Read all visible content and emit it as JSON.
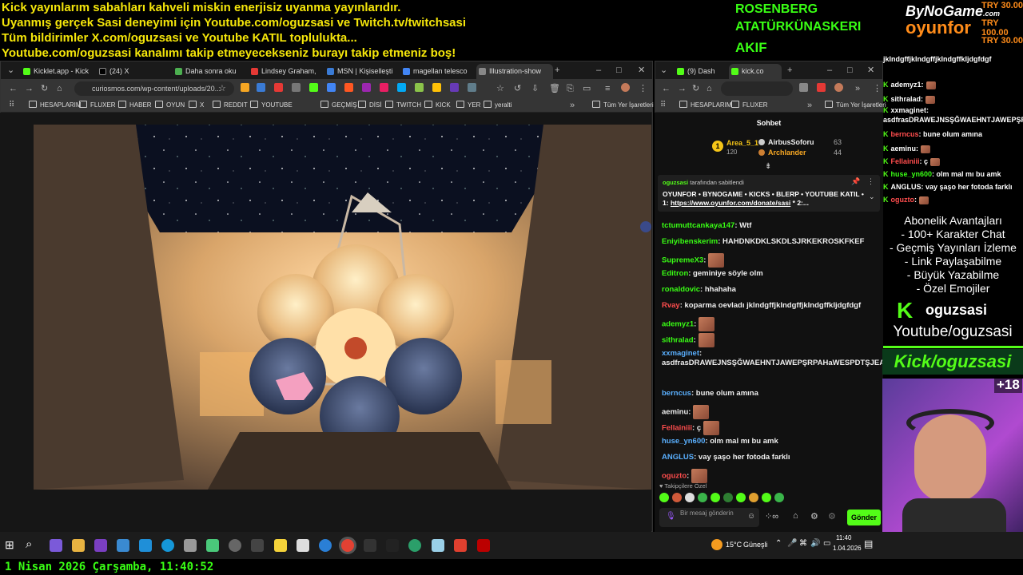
{
  "ticker": [
    "Kick yayınlarım sabahları kahveli miskin enerjisiz uyanma yayınlarıdır.",
    "Uyanmış gerçek Sasi deneyimi için Youtube.com/oguzsasi ve Twitch.tv/twitchsasi",
    "Tüm bildirimler X.com/oguzsasi ve Youtube KATIL toplulukta...",
    "Youtube.com/oguzsasi kanalımı takip etmeyecekseniz burayı takip etmeniz boş!"
  ],
  "donors": [
    "ROSENBERG",
    "ATATÜRKÜNASKERI",
    "AKIF"
  ],
  "sponsor": {
    "brand1": "ByNoGame",
    "brand1_suffix": ".com",
    "brand2": "oyunfor",
    "amounts": [
      "TRY 30.00",
      "TRY 100.00",
      "TRY 30.00"
    ]
  },
  "left_browser": {
    "tabs": [
      "Kicklet.app - Kick",
      "(24) X",
      "Daha sonra oku",
      "Lindsey Graham,",
      "MSN | Kişiselleşti",
      "magellan telesco",
      "Illustration-show"
    ],
    "url": "curiosmos.com/wp-content/uploads/20...",
    "bookmarks": [
      "HESAPLARIM",
      "FLUXER",
      "HABER",
      "OYUN",
      "X",
      "REDDIT",
      "YOUTUBE",
      "GEÇMİŞ",
      "DİSİ",
      "TWITCH",
      "KICK",
      "YER",
      "yeralti"
    ],
    "all_bookmarks": "Tüm Yer İşaretleri"
  },
  "right_browser": {
    "tabs": [
      "(9) Dash",
      "kick.co"
    ],
    "bookmarks": [
      "HESAPLARIM",
      "FLUXER"
    ],
    "all_bookmarks": "Tüm Yer İşaretleri"
  },
  "chat": {
    "title": "Sohbet",
    "leader": {
      "rank": "1",
      "name": "Area_5_1",
      "count": "120"
    },
    "top": [
      {
        "name": "AirbusSoforu",
        "count": "63"
      },
      {
        "name": "Archlander",
        "count": "44"
      }
    ],
    "pinned_by": "oguzsasi",
    "pinned_suffix": "tarafından sabitlendi",
    "pinned_text": "OYUNFOR • BYNOGAME • KICKS • BLERP • YOUTUBE KATIL • 1:",
    "pinned_link": "https://www.oyunfor.com/donate/sasi",
    "pinned_more": "* 2:...",
    "messages": [
      {
        "user": "tctumuttcankaya147",
        "text": ": Wtf",
        "color": "#39ff14"
      },
      {
        "user": "Eniyibenskerim",
        "text": ": HAHDNKDKLSKDLSJRKEKROSKFKEF",
        "color": "#39ff14"
      },
      {
        "user": "SupremeX3",
        "text": ":",
        "color": "#39ff14"
      },
      {
        "user": "Editron",
        "text": ": geminiye söyle olm",
        "color": "#39ff14"
      },
      {
        "user": "ronaldovic",
        "text": ": hhahaha",
        "color": "#39ff14"
      },
      {
        "user": "Rvay",
        "text": ": koparma oevladı jkIndgffjkIndgffjkIndgffkIjdgfdgf",
        "color": "#ff4d4d"
      },
      {
        "user": "ademyz1",
        "text": ":",
        "color": "#39ff14"
      },
      {
        "user": "sithralad",
        "text": ":",
        "color": "#39ff14"
      },
      {
        "user": "xxmaginet",
        "text": ":",
        "color": "#5ab0ff"
      },
      {
        "user": "",
        "text": "asdfrasDRAWEJNSŞĞWAEHNTJAWEPŞRPAHaWESPDTŞJEAWĞAWJETawetwa",
        "color": "#eee"
      },
      {
        "user": "berncus",
        "text": ": bune olum amına",
        "color": "#5ab0ff"
      },
      {
        "user": "aeminu",
        "text": ":",
        "color": "#eee"
      },
      {
        "user": "Fellainiii",
        "text": ": ç",
        "color": "#ff4d4d"
      },
      {
        "user": "huse_yn600",
        "text": ": olm mal mı bu amk",
        "color": "#5ab0ff"
      },
      {
        "user": "ANGLUS",
        "text": ": vay şaşo her fotoda farklı",
        "color": "#5ab0ff"
      },
      {
        "user": "oguzto",
        "text": ":",
        "color": "#ff4d4d"
      }
    ],
    "followers_only": "Takipçilere Özel",
    "input_placeholder": "Bir mesaj gönderin",
    "send": "Gönder"
  },
  "side_chat": [
    {
      "user": "",
      "text": "jkIndgffjkIndgffjkIndgffkIjdgfdgf",
      "color": "#fff"
    },
    {
      "user": "ademyz1",
      "text": ":",
      "color": "#fff"
    },
    {
      "user": "sithralad",
      "text": ":",
      "color": "#fff"
    },
    {
      "user": "xxmaginet",
      "text": ":",
      "color": "#fff"
    },
    {
      "user": "",
      "text": "asdfrasDRAWEJNSŞĞWAEHNTJAWEPŞRPAHaWESPDTŞJEAWĞAWJETawetwa",
      "color": "#fff"
    },
    {
      "user": "berncus",
      "text": ": bune olum amına",
      "color": "#ff4d4d"
    },
    {
      "user": "aeminu",
      "text": ":",
      "color": "#fff"
    },
    {
      "user": "Fellainiii",
      "text": ": ç",
      "color": "#ff4d4d"
    },
    {
      "user": "huse_yn600",
      "text": ": olm mal mı bu amk",
      "color": "#39ff14"
    },
    {
      "user": "ANGLUS",
      "text": ": vay şaşo her fotoda farklı",
      "color": "#fff"
    },
    {
      "user": "oguzto",
      "text": ":",
      "color": "#ff4d4d"
    }
  ],
  "benefits": {
    "title": "Abonelik Avantajları",
    "items": [
      "- 100+ Karakter Chat",
      "- Geçmiş Yayınları İzleme",
      "- Link Paylaşabilme",
      "- Büyük Yazabilme",
      "- Özel Emojiler"
    ]
  },
  "channel": {
    "kick_name": "oguzsasi",
    "youtube": "Youtube/oguzsasi",
    "kick_banner": "Kick/oguzsasi",
    "age": "+18"
  },
  "taskbar": {
    "weather": "15°C",
    "weather_label": "Güneşli",
    "time": "11:40",
    "date": "1.04.2026"
  },
  "clock": "1 Nisan 2026 Çarşamba, 11:40:52",
  "colors": {
    "ticker": "#f5e60a",
    "donor": "#39ff14",
    "kick_green": "#53fc18",
    "orange": "#ff8c1a"
  }
}
